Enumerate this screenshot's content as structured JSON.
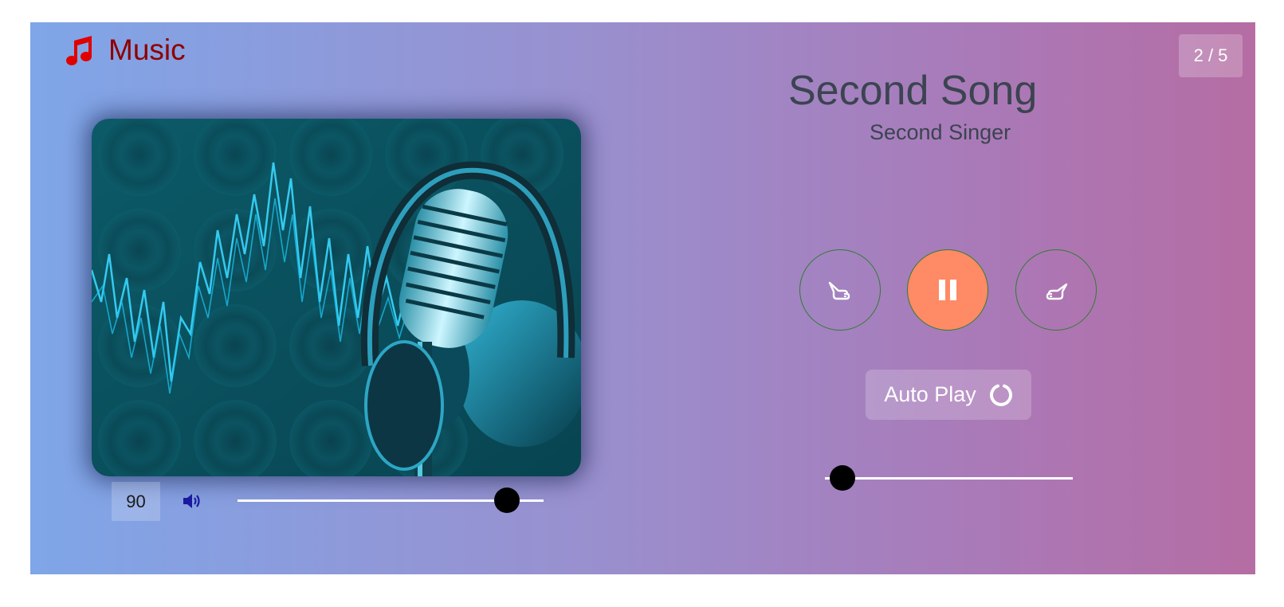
{
  "app": {
    "title": "Music",
    "brand_color": "#e00000",
    "icon": "music-note-icon"
  },
  "counter": {
    "current": 2,
    "total": 5,
    "label": "2 / 5"
  },
  "song": {
    "title": "Second Song",
    "artist": "Second Singer",
    "cover_art": "microphone-with-headphones-and-soundwave"
  },
  "volume": {
    "value": "90",
    "level_percent": 88,
    "icon": "speaker-volume-icon"
  },
  "controls": {
    "prev_icon": "hand-point-left-icon",
    "play_state": "playing",
    "play_icon": "pause-icon",
    "play_color": "#ff8a66",
    "next_icon": "hand-point-right-icon"
  },
  "autoplay": {
    "label": "Auto Play",
    "icon": "circle-notch-icon"
  },
  "progress": {
    "percent": 7
  }
}
